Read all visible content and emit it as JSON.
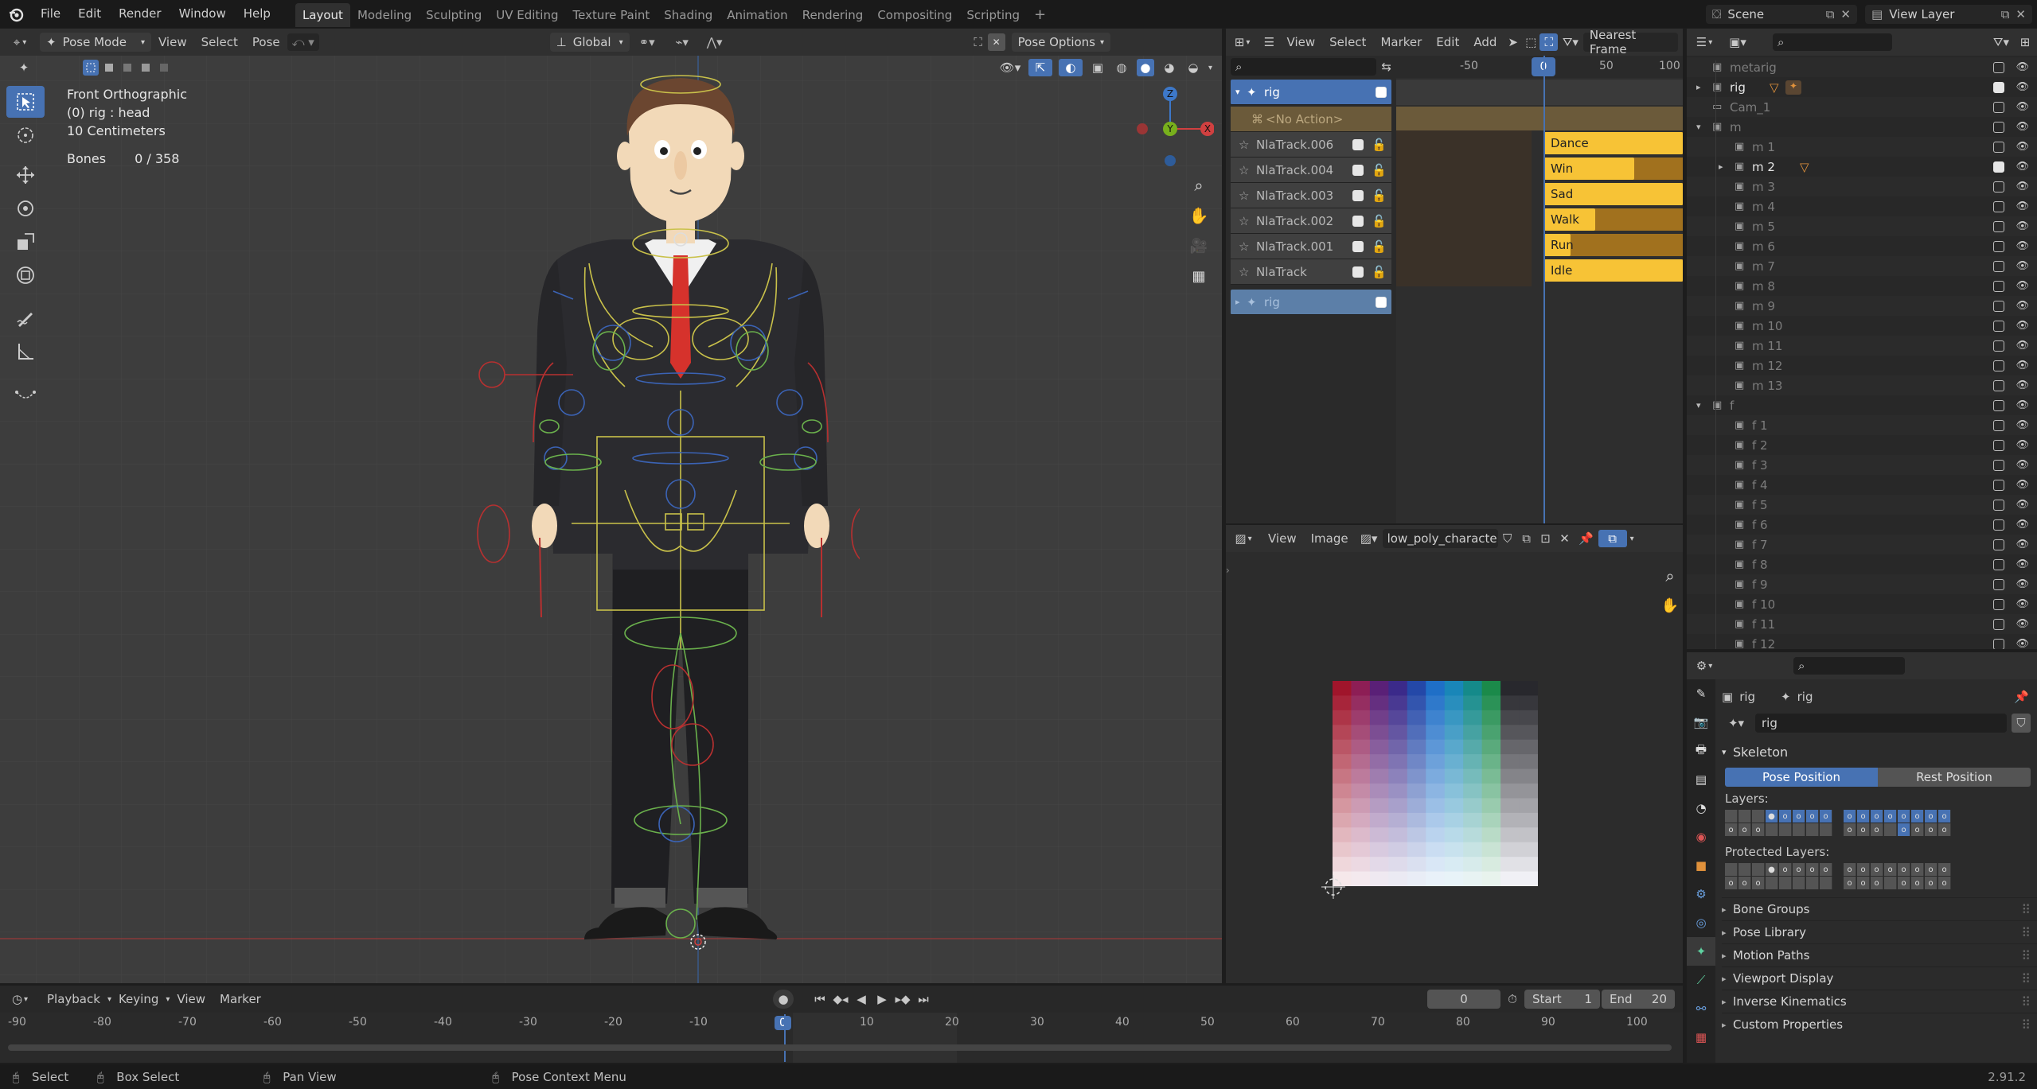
{
  "topbar": {
    "menus": [
      "File",
      "Edit",
      "Render",
      "Window",
      "Help"
    ],
    "workspaces": [
      "Layout",
      "Modeling",
      "Sculpting",
      "UV Editing",
      "Texture Paint",
      "Shading",
      "Animation",
      "Rendering",
      "Compositing",
      "Scripting"
    ],
    "active_workspace": "Layout",
    "add_tab": "+",
    "scene": "Scene",
    "view_layer": "View Layer"
  },
  "viewport": {
    "mode": "Pose Mode",
    "menus": [
      "View",
      "Select",
      "Pose"
    ],
    "orientation": "Global",
    "pose_options": "Pose Options",
    "info": {
      "view_name": "Front Orthographic",
      "object": "(0) rig : head",
      "scale": "10 Centimeters",
      "bones_label": "Bones",
      "bones_value": "0 / 358"
    },
    "gizmo": {
      "z": "Z",
      "y": "Y",
      "x": "X"
    }
  },
  "nla": {
    "menus": [
      "View",
      "Select",
      "Marker",
      "Edit",
      "Add"
    ],
    "snap": "Nearest Frame",
    "ruler": [
      "-50",
      "0",
      "50",
      "100"
    ],
    "current_frame": "0",
    "object": "rig",
    "no_action": "<No Action>",
    "tracks": [
      {
        "name": "NlaTrack.006",
        "strip": "Dance",
        "fill": 1.0
      },
      {
        "name": "NlaTrack.004",
        "strip": "Win",
        "fill": 0.65
      },
      {
        "name": "NlaTrack.003",
        "strip": "Sad",
        "fill": 1.0
      },
      {
        "name": "NlaTrack.002",
        "strip": "Walk",
        "fill": 0.37
      },
      {
        "name": "NlaTrack.001",
        "strip": "Run",
        "fill": 0.19
      },
      {
        "name": "NlaTrack",
        "strip": "Idle",
        "fill": 1.0
      }
    ],
    "bottom_row": "rig"
  },
  "image_editor": {
    "menus": [
      "View",
      "Image"
    ],
    "image_name": "low_poly_character..."
  },
  "outliner": {
    "rows": [
      {
        "name": "metarig",
        "indent": 1,
        "arrow": "",
        "checked": false
      },
      {
        "name": "rig",
        "indent": 1,
        "arrow": "▸",
        "checked": true,
        "extra": "rig"
      },
      {
        "name": "Cam_1",
        "indent": 1,
        "arrow": "",
        "checked": false
      },
      {
        "name": "m",
        "indent": 1,
        "arrow": "▾",
        "checked": false
      },
      {
        "name": "m 1",
        "indent": 2,
        "arrow": "",
        "checked": false
      },
      {
        "name": "m 2",
        "indent": 2,
        "arrow": "▸",
        "checked": true,
        "extra": "mesh"
      },
      {
        "name": "m 3",
        "indent": 2,
        "arrow": "",
        "checked": false
      },
      {
        "name": "m 4",
        "indent": 2,
        "arrow": "",
        "checked": false
      },
      {
        "name": "m 5",
        "indent": 2,
        "arrow": "",
        "checked": false
      },
      {
        "name": "m 6",
        "indent": 2,
        "arrow": "",
        "checked": false
      },
      {
        "name": "m 7",
        "indent": 2,
        "arrow": "",
        "checked": false
      },
      {
        "name": "m 8",
        "indent": 2,
        "arrow": "",
        "checked": false
      },
      {
        "name": "m 9",
        "indent": 2,
        "arrow": "",
        "checked": false
      },
      {
        "name": "m 10",
        "indent": 2,
        "arrow": "",
        "checked": false
      },
      {
        "name": "m 11",
        "indent": 2,
        "arrow": "",
        "checked": false
      },
      {
        "name": "m 12",
        "indent": 2,
        "arrow": "",
        "checked": false
      },
      {
        "name": "m 13",
        "indent": 2,
        "arrow": "",
        "checked": false
      },
      {
        "name": "f",
        "indent": 1,
        "arrow": "▾",
        "checked": false
      },
      {
        "name": "f 1",
        "indent": 2,
        "arrow": "",
        "checked": false
      },
      {
        "name": "f 2",
        "indent": 2,
        "arrow": "",
        "checked": false
      },
      {
        "name": "f 3",
        "indent": 2,
        "arrow": "",
        "checked": false
      },
      {
        "name": "f 4",
        "indent": 2,
        "arrow": "",
        "checked": false
      },
      {
        "name": "f 5",
        "indent": 2,
        "arrow": "",
        "checked": false
      },
      {
        "name": "f 6",
        "indent": 2,
        "arrow": "",
        "checked": false
      },
      {
        "name": "f 7",
        "indent": 2,
        "arrow": "",
        "checked": false
      },
      {
        "name": "f 8",
        "indent": 2,
        "arrow": "",
        "checked": false
      },
      {
        "name": "f 9",
        "indent": 2,
        "arrow": "",
        "checked": false
      },
      {
        "name": "f 10",
        "indent": 2,
        "arrow": "",
        "checked": false
      },
      {
        "name": "f 11",
        "indent": 2,
        "arrow": "",
        "checked": false
      },
      {
        "name": "f 12",
        "indent": 2,
        "arrow": "",
        "checked": false
      }
    ]
  },
  "properties": {
    "crumb_object": "rig",
    "crumb_data": "rig",
    "data_name": "rig",
    "skeleton": "Skeleton",
    "pose_position": "Pose Position",
    "rest_position": "Rest Position",
    "layers": "Layers:",
    "protected_layers": "Protected Layers:",
    "panels": [
      "Bone Groups",
      "Pose Library",
      "Motion Paths",
      "Viewport Display",
      "Inverse Kinematics",
      "Custom Properties"
    ]
  },
  "timeline": {
    "menus": [
      "Playback",
      "Keying",
      "View",
      "Marker"
    ],
    "current_frame": "0",
    "start_label": "Start",
    "start": "1",
    "end_label": "End",
    "end": "20",
    "ruler": [
      "-90",
      "-80",
      "-70",
      "-60",
      "-50",
      "-40",
      "-30",
      "-20",
      "-10",
      "0",
      "10",
      "20",
      "30",
      "40",
      "50",
      "60",
      "70",
      "80",
      "90",
      "100"
    ]
  },
  "status": {
    "select": "Select",
    "box_select": "Box Select",
    "pan_view": "Pan View",
    "context_menu": "Pose Context Menu",
    "version": "2.91.2"
  },
  "colors": {
    "accent": "#4772b3",
    "strip": "#f7c336",
    "strip_dark": "#a1711e",
    "nla_action": "#6b5a3a"
  }
}
